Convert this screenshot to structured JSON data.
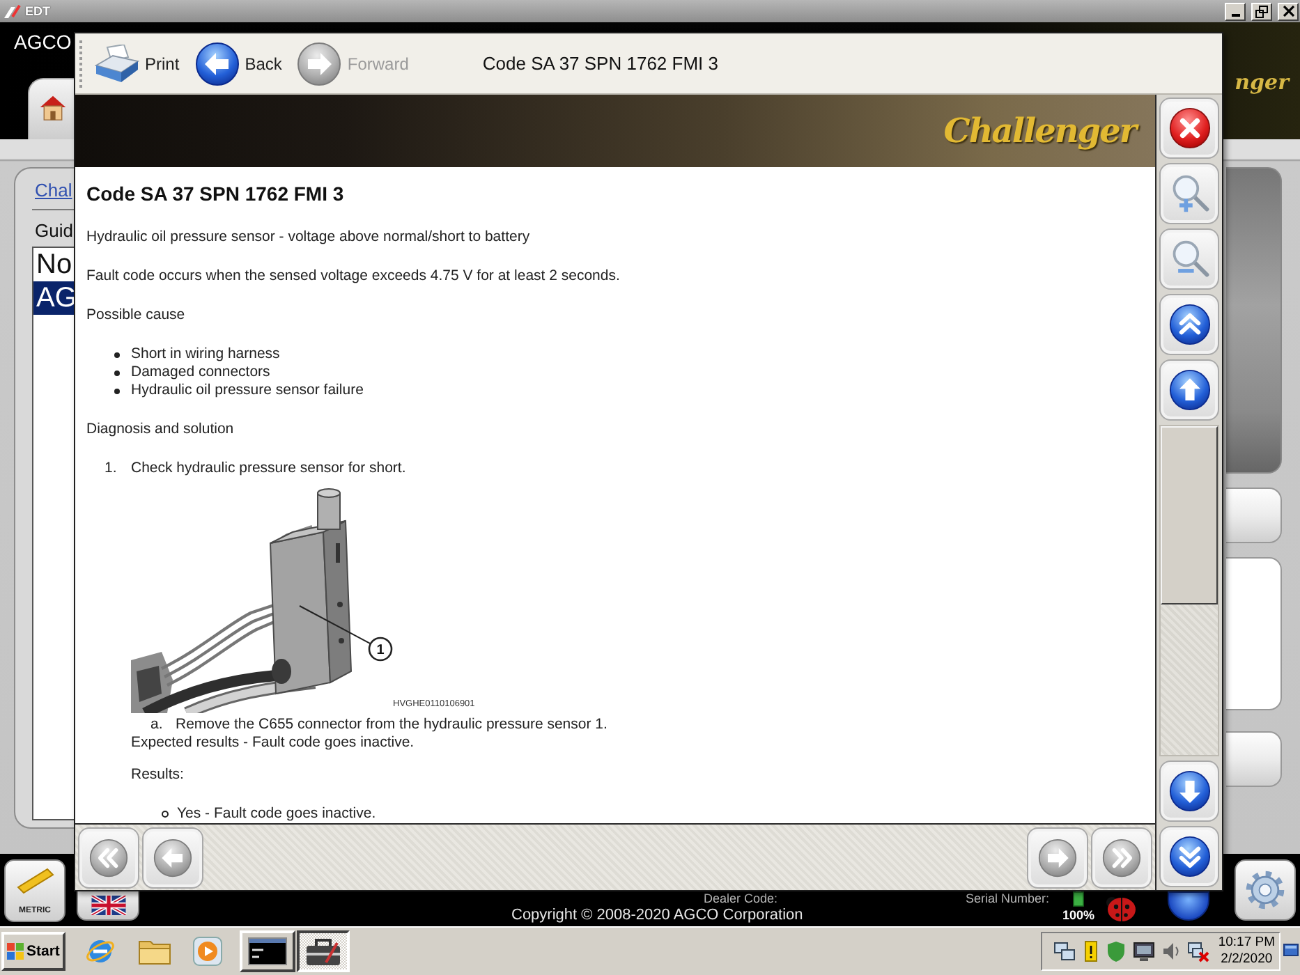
{
  "window": {
    "title": "EDT"
  },
  "header": {
    "brand": "AGCO",
    "logo_fragment": "nger"
  },
  "left_panel": {
    "link": "Chal",
    "label": "Guid",
    "list": [
      {
        "text": "No",
        "selected": false
      },
      {
        "text": "AG",
        "selected": true
      }
    ]
  },
  "dialog": {
    "toolbar": [
      {
        "kind": "print",
        "label": "Print",
        "disabled": false
      },
      {
        "kind": "back",
        "label": "Back",
        "disabled": false
      },
      {
        "kind": "forward",
        "label": "Forward",
        "disabled": true
      }
    ],
    "title": "Code SA 37 SPN 1762 FMI 3",
    "logo": "Challenger",
    "document": {
      "heading": "Code SA 37 SPN 1762 FMI 3",
      "blocks": [
        {
          "kind": "paragraph",
          "text": "Hydraulic oil pressure sensor - voltage above normal/short to battery"
        },
        {
          "kind": "paragraph",
          "text": "Fault code occurs when the sensed voltage exceeds 4.75 V for at least 2 seconds."
        },
        {
          "kind": "paragraph",
          "text": "Possible cause"
        },
        {
          "kind": "bullets",
          "items": [
            "Short in wiring harness",
            "Damaged connectors",
            "Hydraulic oil pressure sensor failure"
          ]
        },
        {
          "kind": "paragraph",
          "text": "Diagnosis and solution"
        },
        {
          "kind": "step",
          "number": "1.",
          "text": "Check hydraulic pressure sensor for short.",
          "figure": {
            "callout": "1",
            "caption": "HVGHE0110106901"
          },
          "substeps": [
            {
              "letter": "a.",
              "text": "Remove the C655 connector from the hydraulic pressure sensor 1."
            }
          ],
          "expected": "Expected results - Fault code goes inactive.",
          "results_label": "Results:",
          "results": [
            "Yes - Fault code goes inactive."
          ]
        }
      ]
    }
  },
  "footer": {
    "units_button": "METRIC",
    "dealer_label": "Dealer Code:",
    "serial_label": "Serial Number:",
    "copyright": "Copyright © 2008-2020 AGCO Corporation",
    "battery": "100%"
  },
  "taskbar": {
    "start": "Start",
    "tasks": [
      {
        "kind": "console",
        "selected": false
      },
      {
        "kind": "toolbox",
        "selected": true
      }
    ],
    "time": "10:17 PM",
    "date": "2/2/2020"
  }
}
